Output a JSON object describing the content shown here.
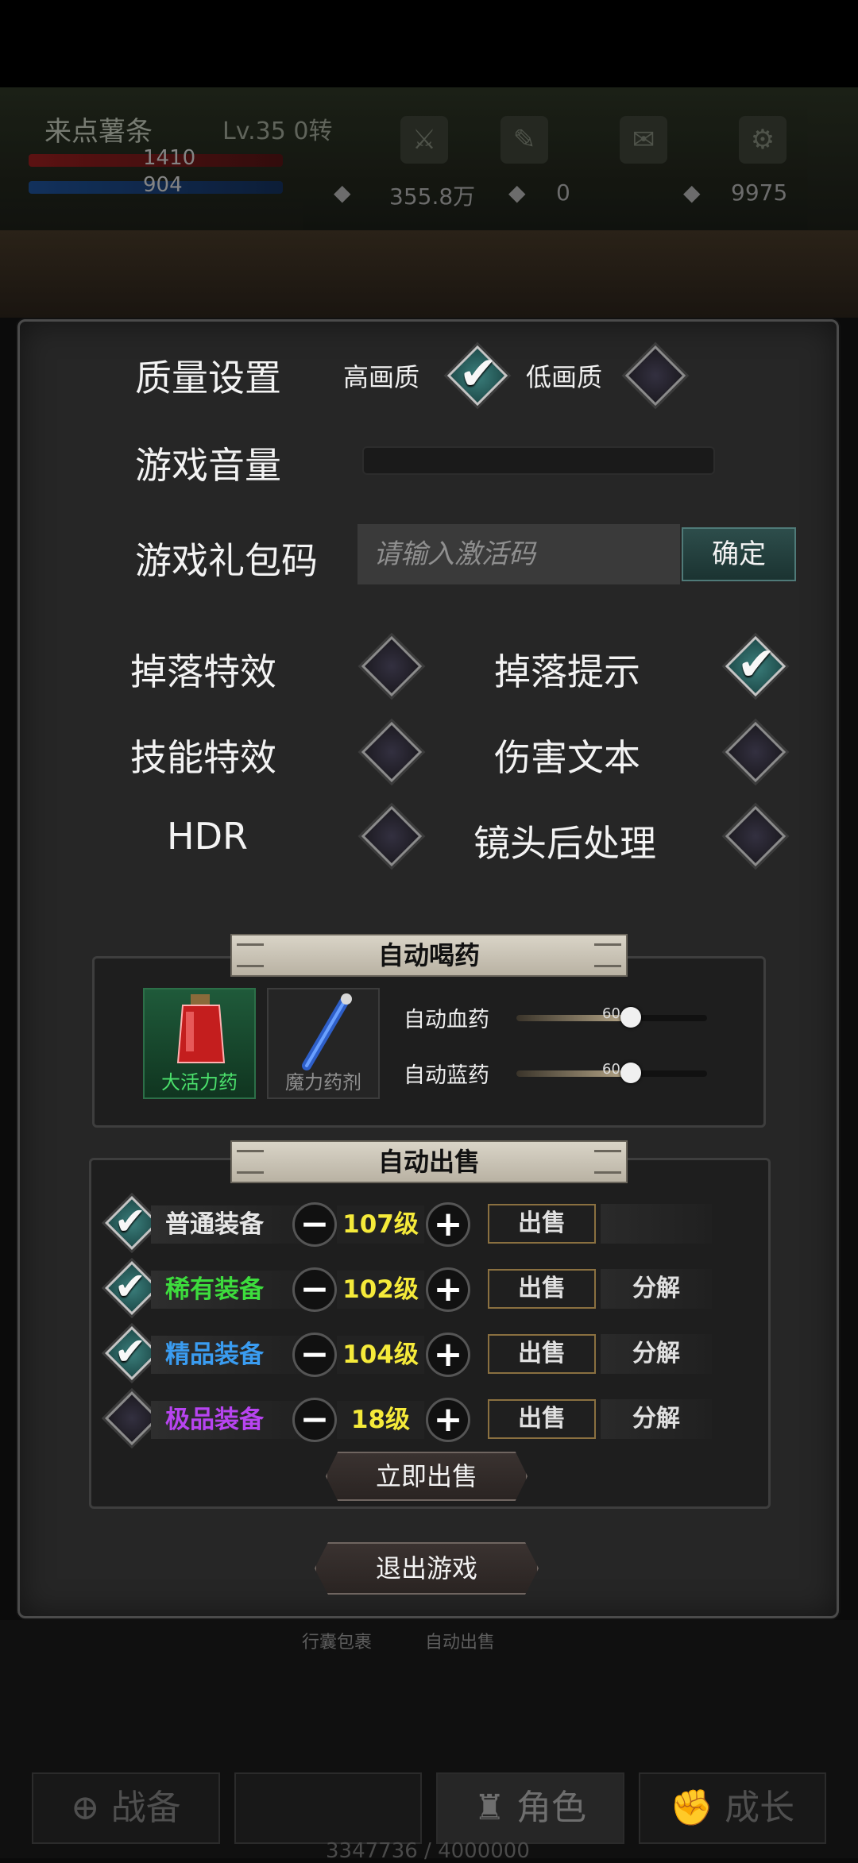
{
  "hud": {
    "player_name": "来点薯条",
    "level": "Lv.35 0转",
    "hp": "1410",
    "mp": "904",
    "gold": "355.8万",
    "gem": "0",
    "crystal": "9975"
  },
  "settings": {
    "quality_label": "质量设置",
    "high_quality": "高画质",
    "low_quality": "低画质",
    "volume_label": "游戏音量",
    "gift_code_label": "游戏礼包码",
    "gift_code_placeholder": "请输入激活码",
    "confirm": "确定",
    "drop_effect": "掉落特效",
    "drop_hint": "掉落提示",
    "skill_effect": "技能特效",
    "damage_text": "伤害文本",
    "hdr": "HDR",
    "post_processing": "镜头后处理"
  },
  "auto_potion": {
    "title": "自动喝药",
    "potion_hp": "大活力药",
    "potion_mp": "魔力药剂",
    "auto_hp_label": "自动血药",
    "auto_mp_label": "自动蓝药",
    "auto_hp_value": "60.0",
    "auto_mp_value": "60.0",
    "auto_hp_fraction": 0.6,
    "auto_mp_fraction": 0.6
  },
  "auto_sell": {
    "title": "自动出售",
    "rows": [
      {
        "tier": "普通装备",
        "color": "#e6e6e6",
        "level": "107级",
        "sell": "出售",
        "decompose": "",
        "checked": true
      },
      {
        "tier": "稀有装备",
        "color": "#3ddc3d",
        "level": "102级",
        "sell": "出售",
        "decompose": "分解",
        "checked": true
      },
      {
        "tier": "精品装备",
        "color": "#3a9cf0",
        "level": "104级",
        "sell": "出售",
        "decompose": "分解",
        "checked": true
      },
      {
        "tier": "极品装备",
        "color": "#b744f0",
        "level": "18级",
        "sell": "出售",
        "decompose": "分解",
        "checked": false
      }
    ],
    "sell_now": "立即出售"
  },
  "exit_game": "退出游戏",
  "bottom": {
    "tab_bag": "行囊包裹",
    "tab_autosell": "自动出售",
    "nav": [
      "战备",
      "",
      "角色",
      "成长"
    ],
    "exp": "3347736 / 4000000"
  },
  "colors": {
    "accent": "#3b7f7c",
    "panel": "#262626"
  }
}
